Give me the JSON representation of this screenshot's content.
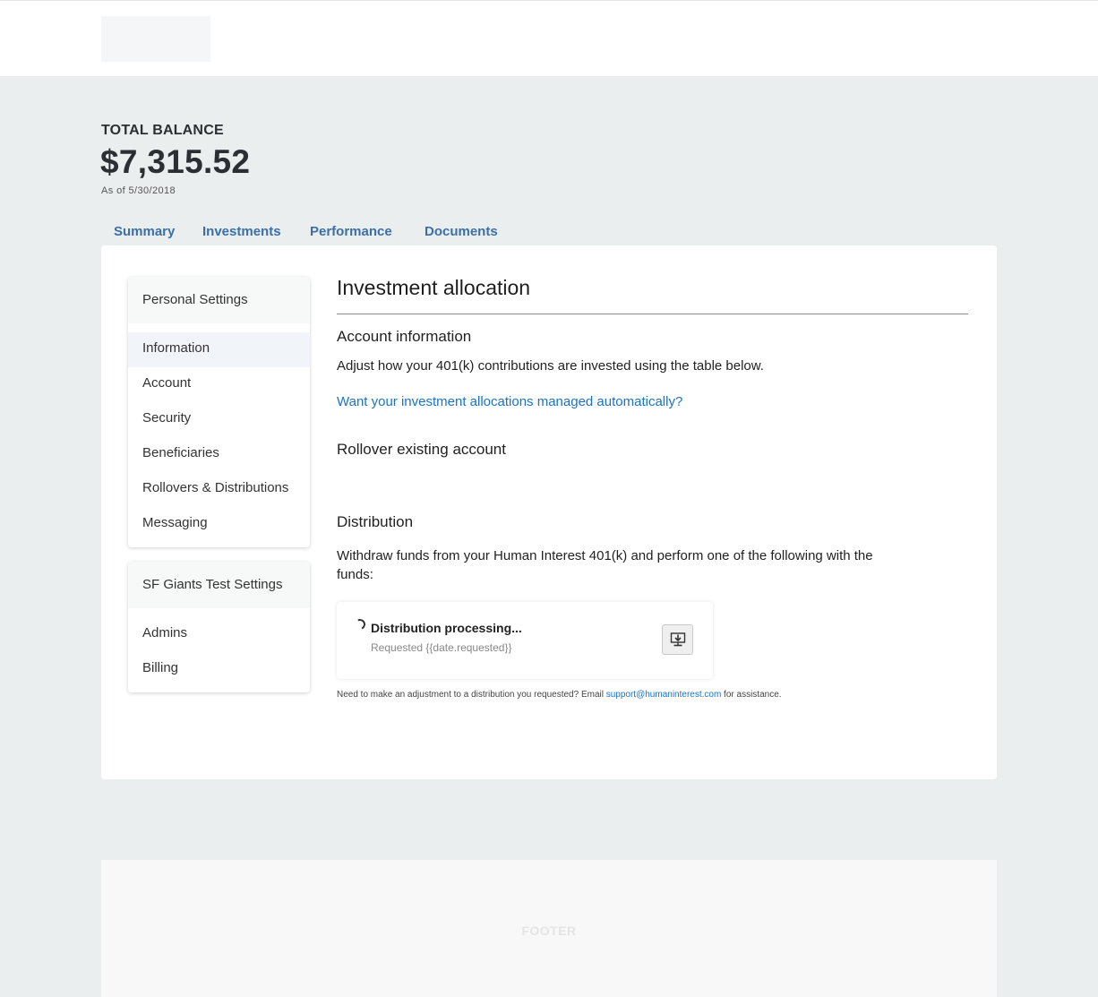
{
  "balance": {
    "label": "TOTAL BALANCE",
    "value": "$7,315.52",
    "as_of": "As of 5/30/2018"
  },
  "tabs": [
    {
      "label": "Summary"
    },
    {
      "label": "Investments"
    },
    {
      "label": "Performance"
    },
    {
      "label": "Documents"
    }
  ],
  "sidebar": {
    "personal": {
      "heading": "Personal Settings",
      "items": [
        {
          "label": "Information",
          "active": true
        },
        {
          "label": "Account"
        },
        {
          "label": "Security"
        },
        {
          "label": "Beneficiaries"
        },
        {
          "label": "Rollovers & Distributions"
        },
        {
          "label": "Messaging"
        }
      ]
    },
    "company": {
      "heading": "SF Giants Test Settings",
      "items": [
        {
          "label": "Admins"
        },
        {
          "label": "Billing"
        }
      ]
    }
  },
  "main": {
    "title": "Investment allocation",
    "account_info": {
      "heading": "Account information",
      "text": "Adjust how your 401(k) contributions are invested using the table below.",
      "link": "Want your investment allocations managed automatically?"
    },
    "rollover": {
      "heading": "Rollover existing account"
    },
    "distribution": {
      "heading": "Distribution",
      "text": "Withdraw funds from your Human Interest 401(k) and perform one of the following with the funds:",
      "card_title": "Distribution processing...",
      "card_subtitle": "Requested {{date.requested}}",
      "download_icon": "download-icon",
      "note_before": "Need to make an adjustment to a distribution you requested? Email ",
      "note_email": "support@humaninterest.com",
      "note_after": " for assistance."
    }
  },
  "footer": {
    "label": "FOOTER"
  }
}
